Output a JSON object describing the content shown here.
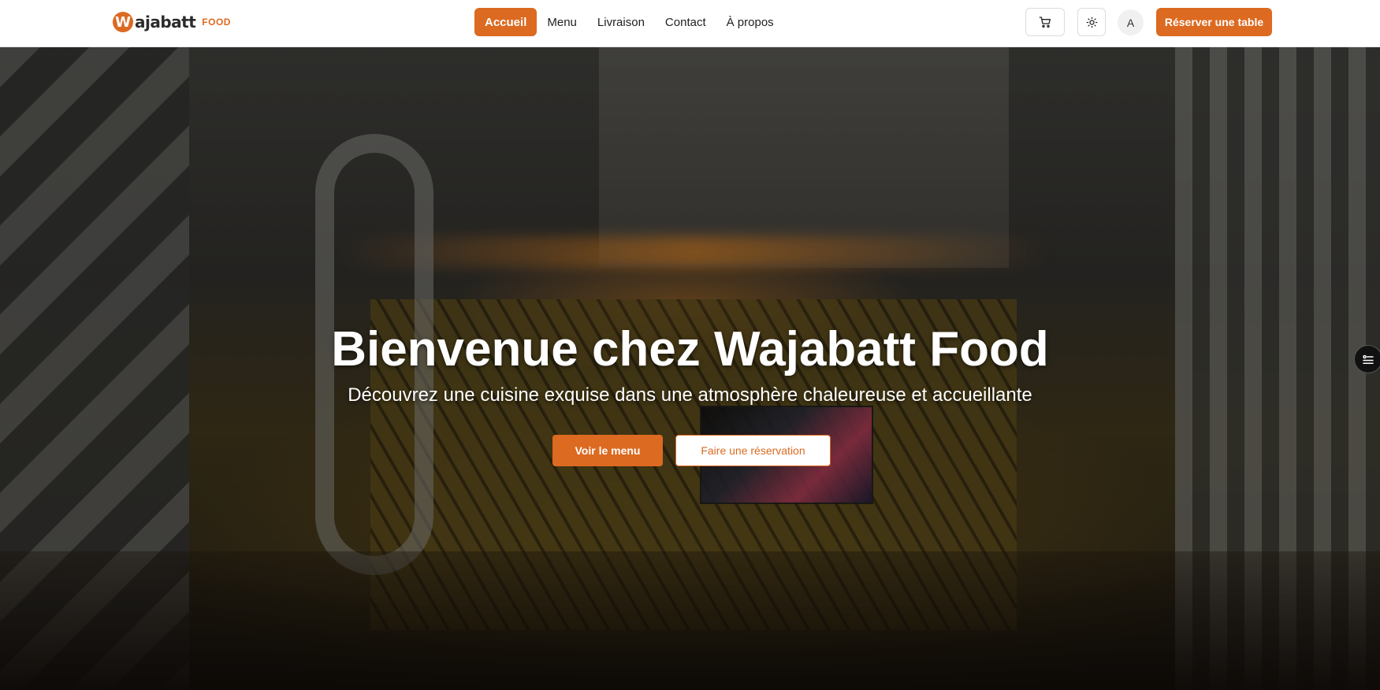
{
  "brand": {
    "badge": "W",
    "name": "ajabatt",
    "suffix": "FOOD"
  },
  "nav": {
    "items": [
      {
        "label": "Accueil",
        "active": true
      },
      {
        "label": "Menu"
      },
      {
        "label": "Livraison"
      },
      {
        "label": "Contact"
      },
      {
        "label": "À propos"
      }
    ]
  },
  "toolbar": {
    "cart_icon": "cart-icon",
    "theme_icon": "sun-icon",
    "avatar_initial": "A",
    "reserve_label": "Réserver une table"
  },
  "hero": {
    "title": "Bienvenue chez Wajabatt Food",
    "subtitle": "Découvrez une cuisine exquise dans une atmosphère chaleureuse et accueillante",
    "primary_label": "Voir le menu",
    "secondary_label": "Faire une réservation"
  },
  "colors": {
    "accent": "#dc6a21",
    "header_bg": "#ffffff"
  }
}
